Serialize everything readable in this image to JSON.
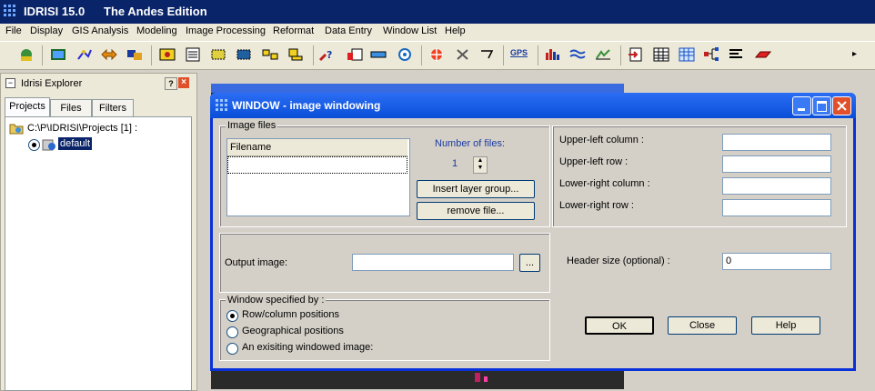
{
  "app": {
    "name": "IDRISI 15.0",
    "edition": "The Andes Edition"
  },
  "menu": [
    "File",
    "Display",
    "GIS Analysis",
    "Modeling",
    "Image Processing",
    "Reformat",
    "Data Entry",
    "Window List",
    "Help"
  ],
  "toolbar": {
    "gps_label": "GPS",
    "overflow": "▸"
  },
  "explorer": {
    "title": "Idrisi Explorer",
    "help_icon": "?",
    "tabs": [
      "Projects",
      "Files",
      "Filters"
    ],
    "project_path": "C:\\P\\IDRISI\\Projects [1] :",
    "project_item": "default"
  },
  "dialog": {
    "title": "WINDOW - image windowing",
    "image_files_label": "Image files",
    "filename_header": "Filename",
    "number_of_files_label": "Number of files:",
    "number_of_files": "1",
    "insert_layer_group": "Insert layer group...",
    "remove_file": "remove file...",
    "upper_left_column_label": "Upper-left column :",
    "upper_left_row_label": "Upper-left row :",
    "lower_right_column_label": "Lower-right column :",
    "lower_right_row_label": "Lower-right row :",
    "output_image_label": "Output image:",
    "browse_label": "...",
    "header_size_label": "Header size (optional) :",
    "header_size_value": "0",
    "window_specified_label": "Window specified by :",
    "options": [
      "Row/column positions",
      "Geographical positions",
      "An exisiting windowed image:"
    ],
    "selected_option": "Row/column positions",
    "ok": "OK",
    "close": "Close",
    "help": "Help"
  }
}
